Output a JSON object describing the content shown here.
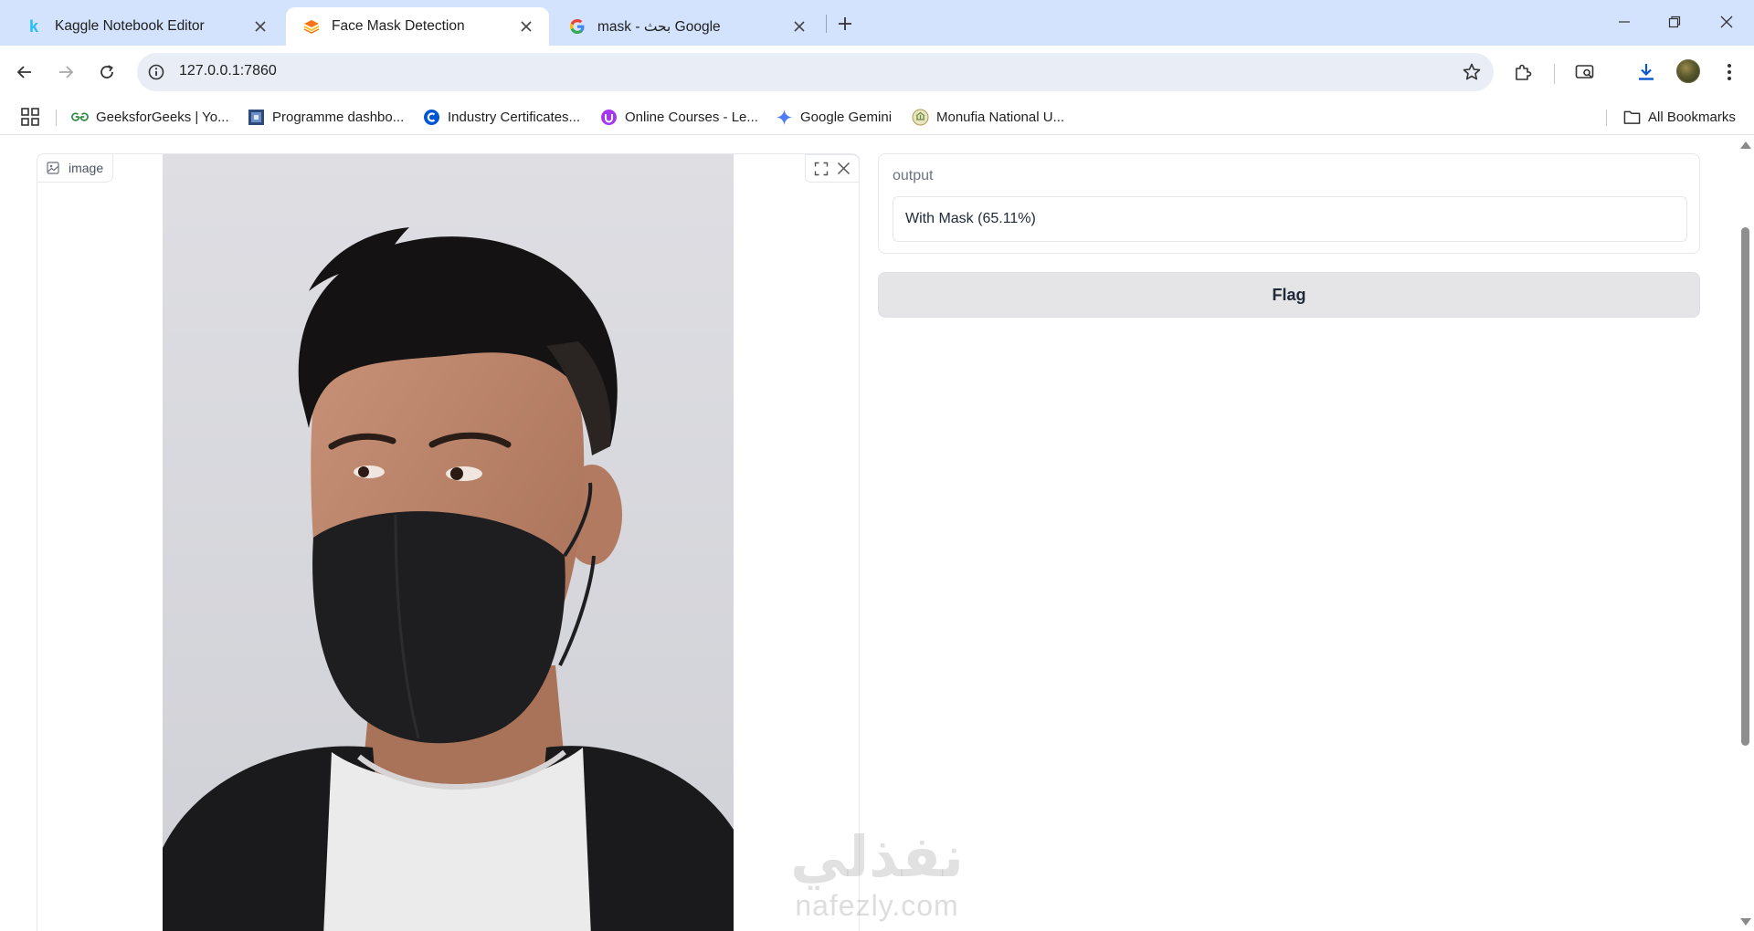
{
  "browser": {
    "tabs": [
      {
        "title": "Kaggle Notebook Editor",
        "favicon": "kaggle-k-icon",
        "active": false
      },
      {
        "title": "Face Mask Detection",
        "favicon": "gradio-icon",
        "active": true
      },
      {
        "title": "mask - بحث Google",
        "favicon": "google-g-icon",
        "active": false
      }
    ],
    "url": "127.0.0.1:7860",
    "bookmarks": [
      {
        "label": "GeeksforGeeks | Yo...",
        "icon": "geeksforgeeks-icon"
      },
      {
        "label": "Programme dashbo...",
        "icon": "programme-icon"
      },
      {
        "label": "Industry Certificates...",
        "icon": "coursera-icon"
      },
      {
        "label": "Online Courses - Le...",
        "icon": "udemy-icon"
      },
      {
        "label": "Google Gemini",
        "icon": "gemini-icon"
      },
      {
        "label": "Monufia National U...",
        "icon": "university-icon"
      }
    ],
    "all_bookmarks": "All Bookmarks"
  },
  "app": {
    "image_label": "image",
    "output_label": "output",
    "output_value": "With Mask (65.11%)",
    "flag_label": "Flag"
  },
  "watermark": {
    "arabic": "نفذلي",
    "latin": "nafezly.com"
  },
  "colors": {
    "tabstrip": "#d3e3fd",
    "omnibox": "#e9eef6",
    "flag_button": "#e5e5e8",
    "download_accent": "#0b57d0"
  }
}
